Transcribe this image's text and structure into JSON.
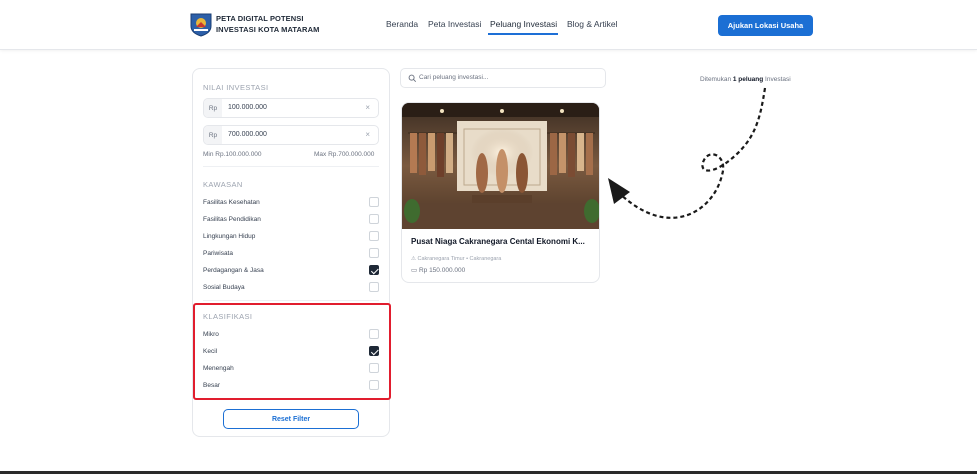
{
  "header": {
    "brand_line1": "PETA DIGITAL POTENSI",
    "brand_line2": "INVESTASI KOTA MATARAM",
    "nav": [
      "Beranda",
      "Peta Investasi",
      "Peluang Investasi",
      "Blog & Artikel"
    ],
    "active_nav": "Peluang Investasi",
    "cta_label": "Ajukan Lokasi Usaha",
    "accent_color": "#1b6fd4"
  },
  "filters": {
    "nilai_title": "NILAI INVESTASI",
    "currency_prefix": "Rp",
    "min_value": "100.000.000",
    "max_value": "700.000.000",
    "clear_icon": "×",
    "min_label": "Min Rp.100.000.000",
    "max_label": "Max Rp.700.000.000",
    "kawasan_title": "KAWASAN",
    "kawasan": [
      {
        "label": "Fasilitas Kesehatan",
        "checked": false
      },
      {
        "label": "Fasilitas Pendidikan",
        "checked": false
      },
      {
        "label": "Lingkungan Hidup",
        "checked": false
      },
      {
        "label": "Pariwisata",
        "checked": false
      },
      {
        "label": "Perdagangan & Jasa",
        "checked": true
      },
      {
        "label": "Sosial Budaya",
        "checked": false
      }
    ],
    "klasifikasi_title": "KLASIFIKASI",
    "klasifikasi": [
      {
        "label": "Mikro",
        "checked": false
      },
      {
        "label": "Kecil",
        "checked": true
      },
      {
        "label": "Menengah",
        "checked": false
      },
      {
        "label": "Besar",
        "checked": false
      }
    ],
    "reset_label": "Reset Filter",
    "highlight_color": "#e11d2e"
  },
  "search": {
    "placeholder": "Cari peluang investasi..."
  },
  "results": {
    "prefix": "Ditemukan",
    "count_text": "1 peluang",
    "suffix": "Investasi"
  },
  "card": {
    "title": "Pusat Niaga Cakranegara Cental Ekonomi K...",
    "location": "Cakranegara Timur • Cakranegara",
    "price": "Rp 150.000.000"
  }
}
